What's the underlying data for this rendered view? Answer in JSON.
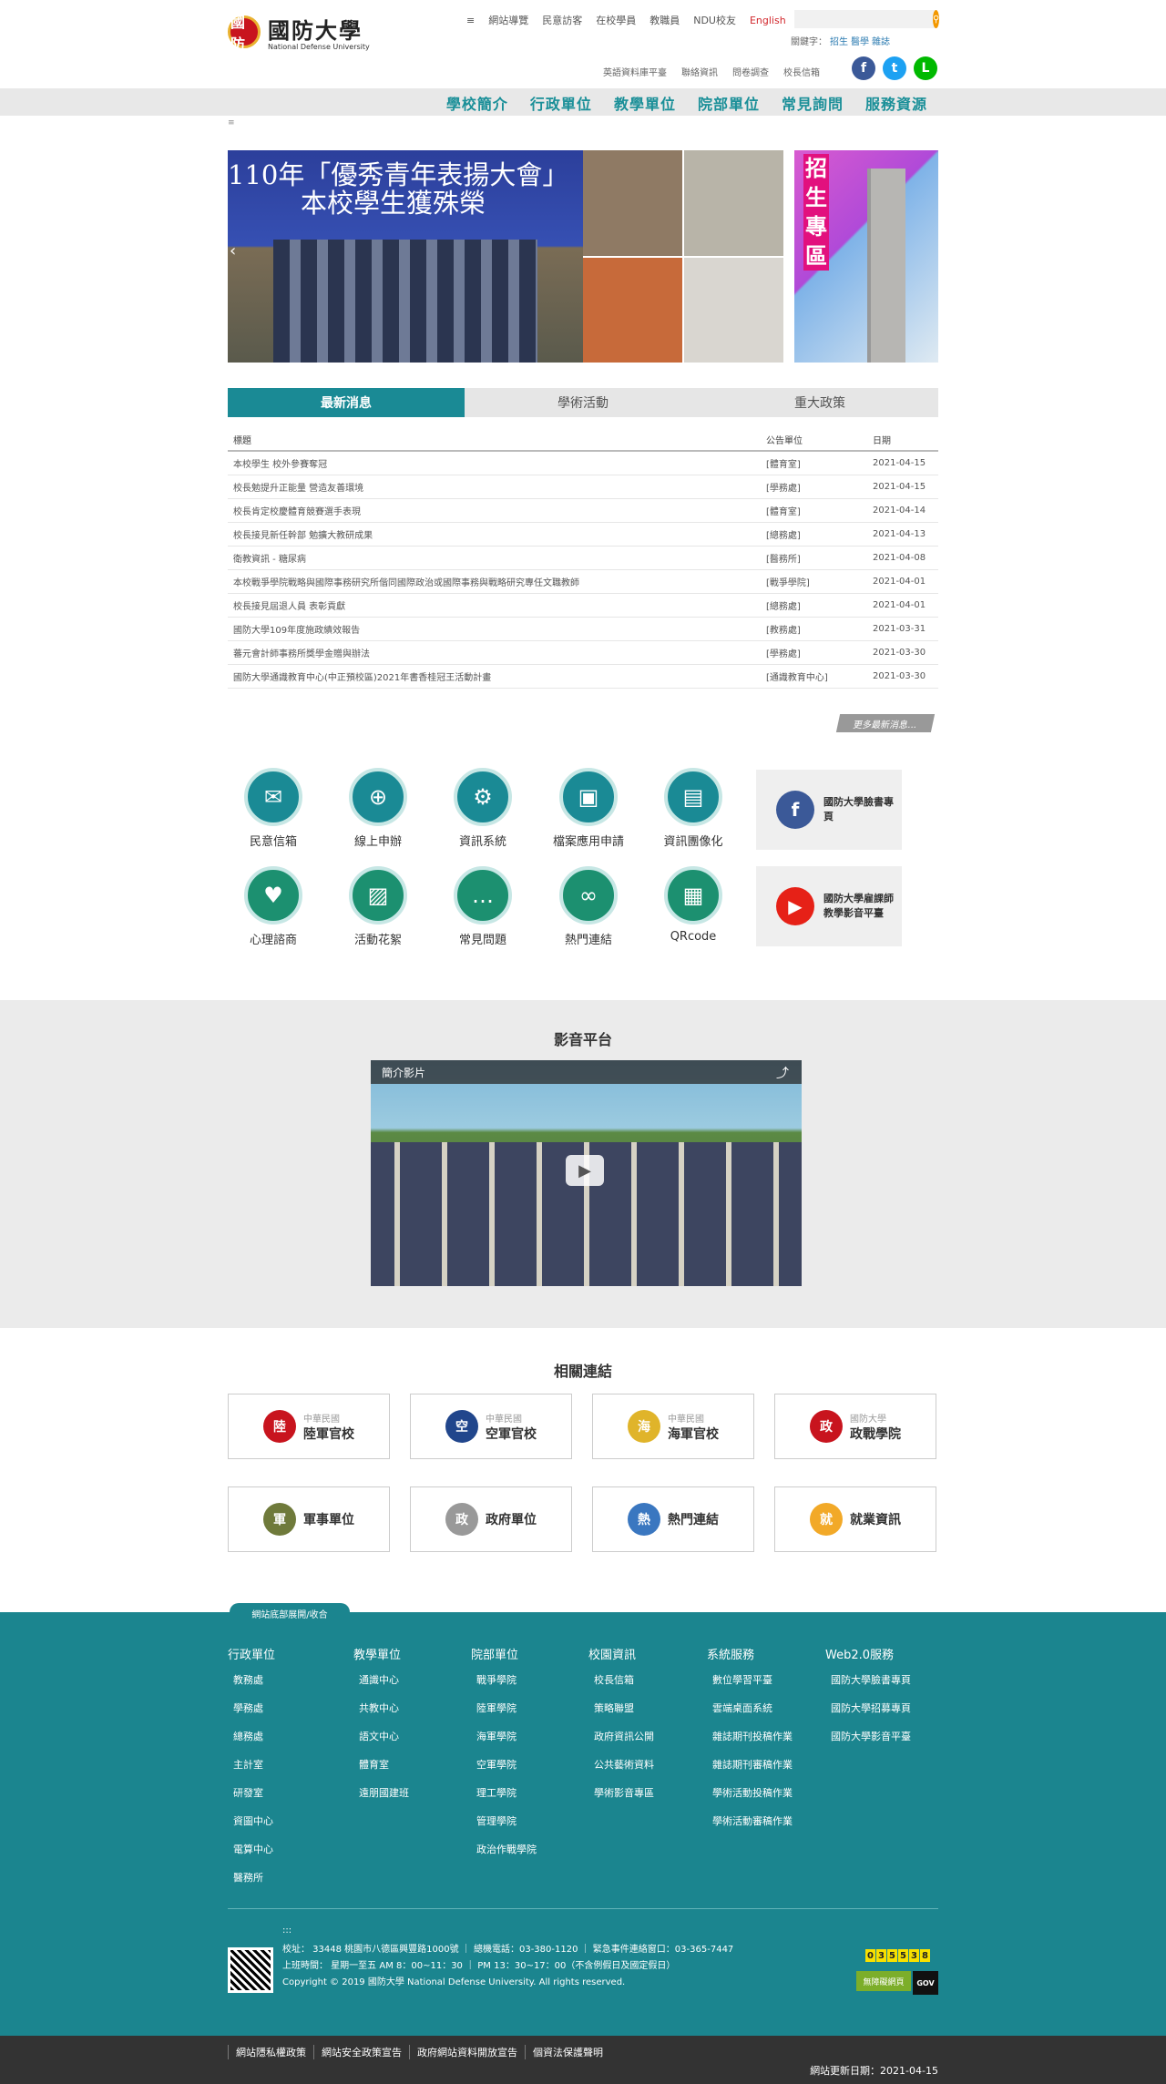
{
  "header": {
    "logo_seal": "國防",
    "logo_zh": "國防大學",
    "logo_en": "National Defense University",
    "top_links": [
      "網站導覽",
      "民意訪客",
      "在校學員",
      "教職員",
      "NDU校友",
      "English"
    ],
    "search_placeholder": "",
    "keywords_label": "關鍵字：",
    "keywords": [
      "招生",
      "醫學",
      "雜誌"
    ],
    "sub_links": [
      "英語資料庫平臺",
      "聯絡資訊",
      "問卷調查",
      "校長信箱"
    ],
    "menu_icon": "≡"
  },
  "main_nav": [
    "學校簡介",
    "行政單位",
    "教學單位",
    "院部單位",
    "常見詢問",
    "服務資源"
  ],
  "banner": {
    "title_line1": "110年「優秀青年表揚大會」",
    "title_line2": "本校學生獲殊榮",
    "side_text": "招生專區",
    "prev_arrow": "‹"
  },
  "tabs": [
    {
      "label": "最新消息",
      "active": true
    },
    {
      "label": "學術活動",
      "active": false
    },
    {
      "label": "重大政策",
      "active": false
    }
  ],
  "news": {
    "columns": [
      "標題",
      "公告單位",
      "日期"
    ],
    "rows": [
      [
        "本校學生 校外參賽奪冠",
        "[體育室]",
        "2021-04-15"
      ],
      [
        "校長勉提升正能量 營造友善環境",
        "[學務處]",
        "2021-04-15"
      ],
      [
        "校長肯定校慶體育競賽選手表現",
        "[體育室]",
        "2021-04-14"
      ],
      [
        "校長接見新任幹部 勉擴大教研成果",
        "[總務處]",
        "2021-04-13"
      ],
      [
        "衛教資訊 - 糖尿病",
        "[醫務所]",
        "2021-04-08"
      ],
      [
        "本校戰爭學院戰略與國際事務研究所偕同國際政治或國際事務與戰略研究專任文職教師",
        "[戰爭學院]",
        "2021-04-01"
      ],
      [
        "校長接見屆退人員 表彰貢獻",
        "[總務處]",
        "2021-04-01"
      ],
      [
        "國防大學109年度施政績效報告",
        "[教務處]",
        "2021-03-31"
      ],
      [
        "蕃元會計師事務所獎學金贈與辦法",
        "[學務處]",
        "2021-03-30"
      ],
      [
        "國防大學通識教育中心(中正預校區)2021年書香桂冠王活動計畫",
        "[通識教育中心]",
        "2021-03-30"
      ]
    ],
    "more_label": "更多最新消息..."
  },
  "services": [
    {
      "label": "民意信箱",
      "icon": "✉"
    },
    {
      "label": "線上申辦",
      "icon": "⊕"
    },
    {
      "label": "資訊系統",
      "icon": "⚙"
    },
    {
      "label": "檔案應用申請",
      "icon": "▣"
    },
    {
      "label": "資訊團像化",
      "icon": "▤"
    },
    {
      "label": "心理諮商",
      "icon": "♥"
    },
    {
      "label": "活動花絮",
      "icon": "▨"
    },
    {
      "label": "常見問題",
      "icon": "…"
    },
    {
      "label": "熱門連結",
      "icon": "∞"
    },
    {
      "label": "QRcode",
      "icon": "▦"
    }
  ],
  "social_boxes": [
    {
      "label": "國防大學臉書專頁",
      "icon": "f",
      "color": "#3b5998"
    },
    {
      "label": "國防大學雇課師教學影音平臺",
      "icon": "▶",
      "color": "#e62117"
    }
  ],
  "social_icons": [
    {
      "icon": "f",
      "color": "#3b5998"
    },
    {
      "icon": "t",
      "color": "#1da1f2"
    },
    {
      "icon": "L",
      "color": "#00b900"
    }
  ],
  "video": {
    "section_title": "影音平台",
    "bar_title": "簡介影片",
    "play_icon": "▶",
    "share_icon": "⤴"
  },
  "links": {
    "section_title": "相關連結",
    "items": [
      {
        "small": "中華民國",
        "big": "陸軍官校",
        "color": "#c8141e",
        "icon": "陸"
      },
      {
        "small": "中華民國",
        "big": "空軍官校",
        "color": "#21468c",
        "icon": "空"
      },
      {
        "small": "中華民國",
        "big": "海軍官校",
        "color": "#e0b42a",
        "icon": "海"
      },
      {
        "small": "國防大學",
        "big": "政戰學院",
        "color": "#c8141e",
        "icon": "政"
      },
      {
        "small": "",
        "big": "軍事單位",
        "color": "#6f7a3b",
        "icon": "軍"
      },
      {
        "small": "",
        "big": "政府單位",
        "color": "#999999",
        "icon": "政"
      },
      {
        "small": "",
        "big": "熱門連結",
        "color": "#3a77c0",
        "icon": "熱"
      },
      {
        "small": "",
        "big": "就業資訊",
        "color": "#f2a928",
        "icon": "就"
      }
    ]
  },
  "footer": {
    "toggle_label": "網站底部展開/收合",
    "columns": [
      {
        "title": "行政單位",
        "items": [
          "教務處",
          "學務處",
          "總務處",
          "主計室",
          "研發室",
          "資圖中心",
          "電算中心",
          "醫務所"
        ]
      },
      {
        "title": "教學單位",
        "items": [
          "通識中心",
          "共教中心",
          "語文中心",
          "體育室",
          "遠朋國建班"
        ]
      },
      {
        "title": "院部單位",
        "items": [
          "戰爭學院",
          "陸軍學院",
          "海軍學院",
          "空軍學院",
          "理工學院",
          "管理學院",
          "政治作戰學院"
        ]
      },
      {
        "title": "校園資訊",
        "items": [
          "校長信箱",
          "策略聯盟",
          "政府資訊公開",
          "公共藝術資料",
          "學術影音專區"
        ]
      },
      {
        "title": "系統服務",
        "items": [
          "數位學習平臺",
          "雲端桌面系統",
          "雜誌期刊投稿作業",
          "雜誌期刊審稿作業",
          "學術活動投稿作業",
          "學術活動審稿作業"
        ]
      },
      {
        "title": "Web2.0服務",
        "items": [
          "國防大學臉書專頁",
          "國防大學招募專頁",
          "國防大學影音平臺"
        ]
      }
    ],
    "mark": ":::",
    "address": "校址： 33448 桃園市八德區興豐路1000號 ｜ 總機電話：03-380-1120 ｜ 緊急事件連絡窗口：03-365-7447",
    "hours": "上班時間： 星期一至五 AM 8：00~11：30 ｜ PM 13：30~17：00（不含例假日及國定假日）",
    "copyright": "Copyright © 2019 國防大學 National Defense University. All rights reserved.",
    "counter": [
      "0",
      "3",
      "5",
      "5",
      "3",
      "8"
    ],
    "badge_label": "無障礙網頁",
    "gov_label": "GOV"
  },
  "bottom": {
    "policies": [
      "網站隱私權政策",
      "網站安全政策宣告",
      "政府網站資料開放宣告",
      "個資法保護聲明"
    ],
    "update": "網站更新日期：2021-04-15"
  }
}
